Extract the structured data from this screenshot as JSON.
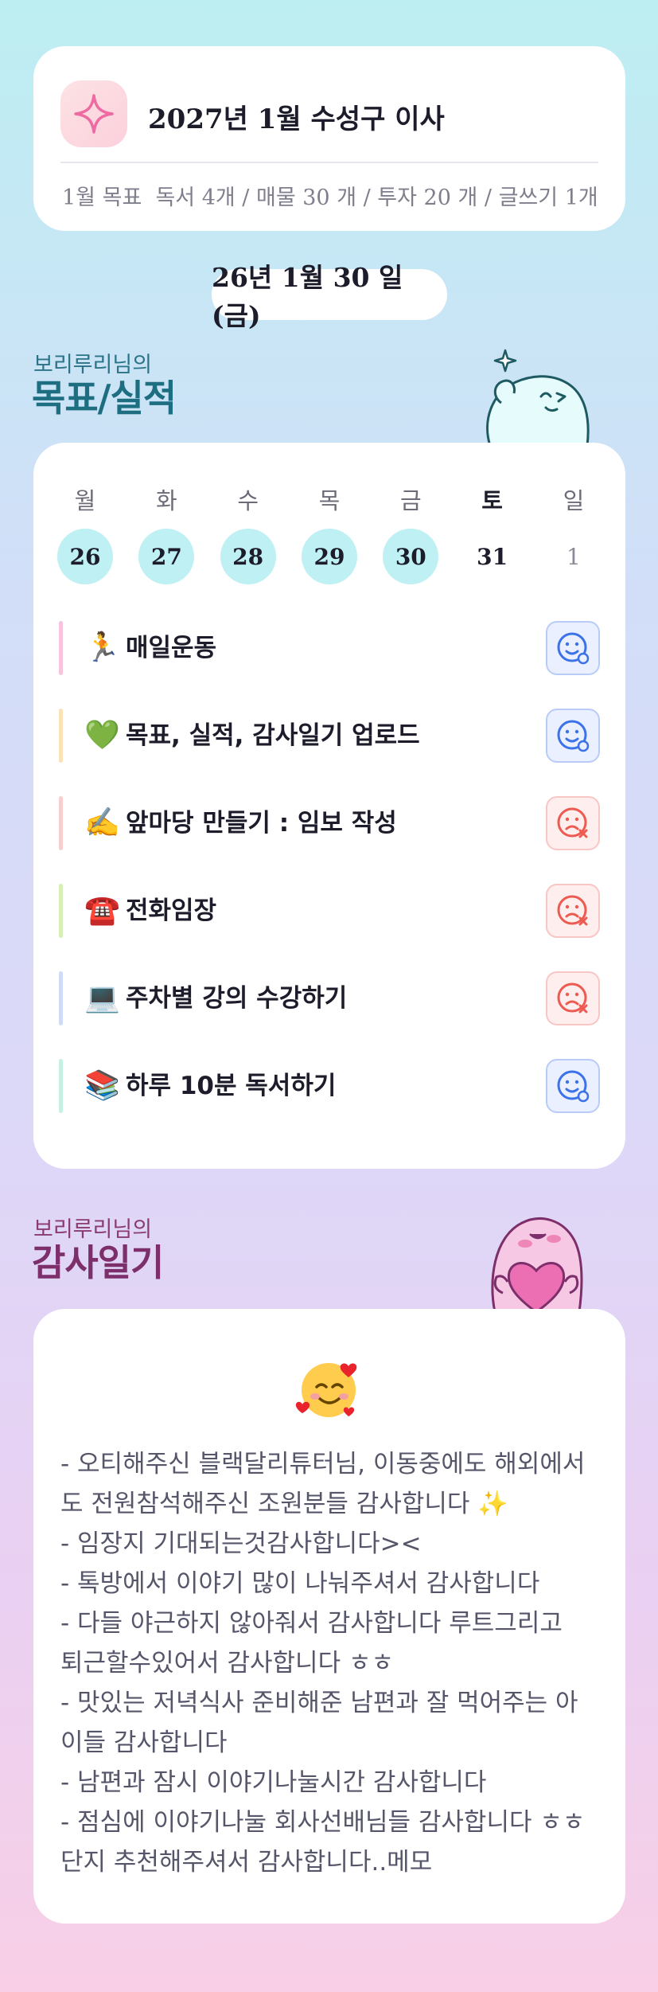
{
  "goal": {
    "title": "2027년 1월 수성구 이사",
    "subtitle": "1월 목표  독서 4개 / 매물 30 개 / 투자 20 개 / 글쓰기 1개"
  },
  "date_pill": "26년 1월 30 일(금)",
  "performance": {
    "label": "보리루리님의",
    "title": "목표/실적",
    "weekdays": [
      "월",
      "화",
      "수",
      "목",
      "금",
      "토",
      "일"
    ],
    "dates": [
      "26",
      "27",
      "28",
      "29",
      "30",
      "31",
      "1"
    ],
    "completed_days": [
      true,
      true,
      true,
      true,
      true,
      false,
      false
    ],
    "tasks": [
      {
        "emoji": "🏃",
        "label": "매일운동",
        "bar_color": "#f6c4dc",
        "status": "good"
      },
      {
        "emoji": "💚",
        "label": "목표, 실적, 감사일기 업로드",
        "bar_color": "#fbe2b6",
        "status": "good"
      },
      {
        "emoji": "✍️",
        "label": "앞마당 만들기 : 임보 작성",
        "bar_color": "#f8cfcf",
        "status": "bad"
      },
      {
        "emoji": "☎️",
        "label": "전화임장",
        "bar_color": "#d6efb8",
        "status": "bad"
      },
      {
        "emoji": "💻",
        "label": "주차별 강의 수강하기",
        "bar_color": "#cfdcf8",
        "status": "bad"
      },
      {
        "emoji": "📚",
        "label": "하루 10분 독서하기",
        "bar_color": "#c6f0e0",
        "status": "good"
      }
    ]
  },
  "gratitude": {
    "label": "보리루리님의",
    "title": "감사일기",
    "emoji": "smiling-face-with-hearts",
    "lines": [
      "- 오티해주신 블랙달리튜터님, 이동중에도 해외에서",
      "도 전원참석해주신 조원분들 감사합니다 ✨",
      "- 임장지 기대되는것감사합니다><",
      "- 톡방에서 이야기 많이 나눠주셔서 감사합니다",
      "- 다들 야근하지 않아줘서 감사합니다 루트그리고",
      "퇴근할수있어서 감사합니다 ㅎㅎ",
      "- 맛있는 저녁식사 준비해준 남편과 잘 먹어주는 아",
      "이들 감사합니다",
      "- 남편과 잠시 이야기나눌시간 감사합니다",
      "- 점심에 이야기나눌 회사선배님들 감사합니다 ㅎㅎ",
      "단지 추천해주셔서 감사합니다..메모"
    ]
  },
  "colors": {
    "accent_teal": "#1e6e82",
    "accent_plum": "#7c2f6a",
    "done_circle": "#bff0f4",
    "good_status": "#3c72e8",
    "bad_status": "#ec5a50"
  }
}
